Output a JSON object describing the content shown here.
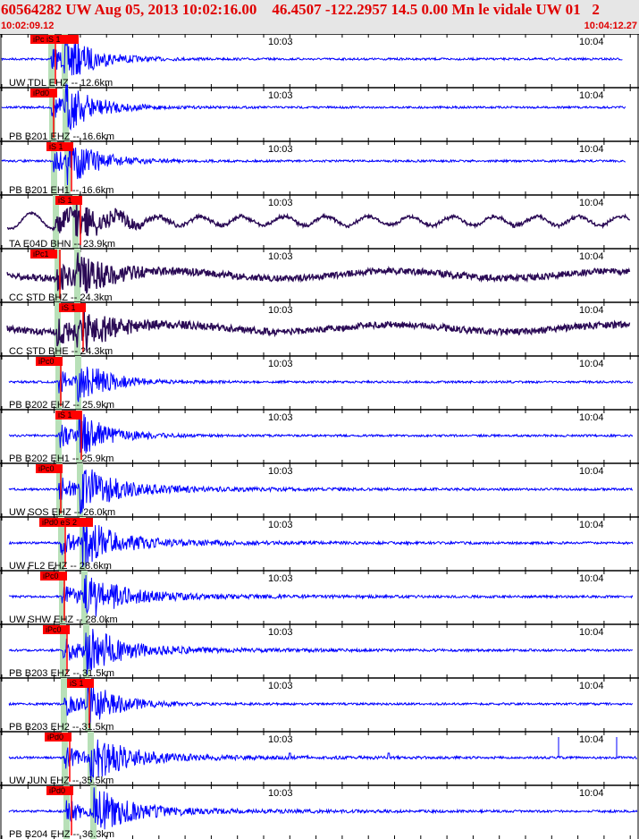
{
  "header": {
    "title": "60564282 UW Aug 05, 2013 10:02:16.00    46.4507 -122.2957 14.5 0.00 Mn le vidale UW 01   2",
    "start_time": "10:02:09.12",
    "end_time": "10:04:12.27"
  },
  "time_labels": [
    "10:03",
    "10:04"
  ],
  "colors": {
    "header_text": "#e00000",
    "trace_blue": "#0000ff",
    "trace_purple": "#2a0a55",
    "pick": "#ff0000",
    "band": "#b8e0b8"
  },
  "panels": [
    {
      "station": "UW TDL EHZ -- 12.6km",
      "pick": "iPc iS 1"
    },
    {
      "station": "PB B201 EHZ -- 16.6km",
      "pick": "iPd0"
    },
    {
      "station": "PB B201 EH1 -- 16.6km",
      "pick": "iS 1"
    },
    {
      "station": "TA E04D BHN -- 23.9km",
      "pick": "iS 1"
    },
    {
      "station": "CC STD BHZ -- 24.3km",
      "pick": "iPc1"
    },
    {
      "station": "CC STD BHE -- 24.3km",
      "pick": "iS 1"
    },
    {
      "station": "PB B202 EHZ -- 25.9km",
      "pick": "iPc0"
    },
    {
      "station": "PB B202 EH1 -- 25.9km",
      "pick": "iS 1"
    },
    {
      "station": "UW SOS EHZ -- 26.0km",
      "pick": "iPc0"
    },
    {
      "station": "UW FL2 EHZ -- 28.6km",
      "pick": "iPd0 eS 2"
    },
    {
      "station": "UW SHW EHZ -- 28.0km",
      "pick": "iPc0"
    },
    {
      "station": "PB B203 EHZ -- 31.5km",
      "pick": "iPc0"
    },
    {
      "station": "PB B203 EH2 -- 31.5km",
      "pick": "iS 1"
    },
    {
      "station": "UW JUN EHZ -- 35.5km",
      "pick": "iPd0"
    },
    {
      "station": "PB B204 EHZ -- 36.3km",
      "pick": "iPd0"
    }
  ]
}
